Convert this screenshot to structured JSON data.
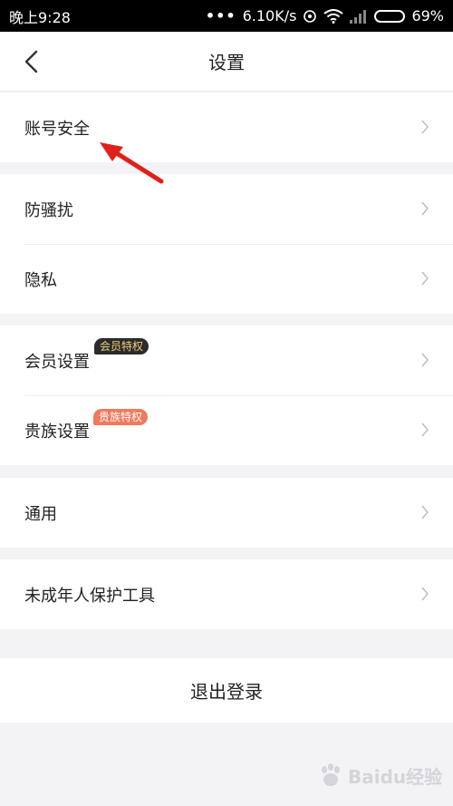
{
  "status_bar": {
    "time": "晚上9:28",
    "dots": "•••",
    "network_speed": "6.10K/s",
    "battery_percent": "69%",
    "battery_level": 0.69
  },
  "header": {
    "title": "设置"
  },
  "groups": [
    {
      "items": [
        {
          "label": "账号安全"
        }
      ]
    },
    {
      "items": [
        {
          "label": "防骚扰"
        },
        {
          "label": "隐私"
        }
      ]
    },
    {
      "items": [
        {
          "label": "会员设置",
          "badge": "会员特权"
        },
        {
          "label": "贵族设置",
          "badge": "贵族特权"
        }
      ]
    },
    {
      "items": [
        {
          "label": "通用"
        }
      ]
    },
    {
      "items": [
        {
          "label": "未成年人保护工具"
        }
      ]
    }
  ],
  "logout": {
    "label": "退出登录"
  },
  "watermark": {
    "text": "Baidu经验"
  },
  "colors": {
    "accent_red": "#e0201b",
    "vip_badge_bg": "#2b2b2b",
    "vip_badge_text": "#f0cd7b",
    "noble_badge_bg": "#f07a5c"
  }
}
